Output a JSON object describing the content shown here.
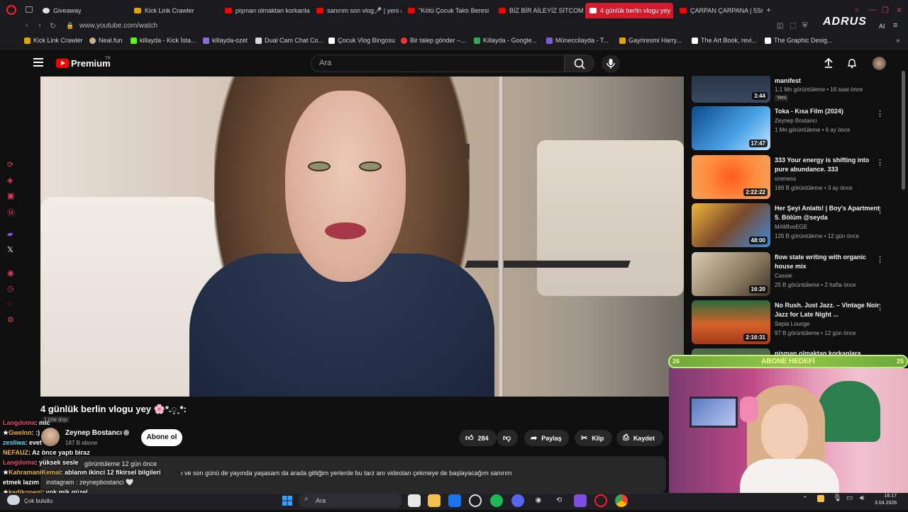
{
  "browser": {
    "tabs": [
      {
        "label": "Giveaway",
        "active": false
      },
      {
        "label": "Kick Link Crawler",
        "active": false
      },
      {
        "label": "pişman olmaktan korkanla",
        "active": false
      },
      {
        "label": "sanırım son vlog🎤 | yeni a",
        "active": false
      },
      {
        "label": "\"Kötü Çocuk Taktı Beresi",
        "active": false
      },
      {
        "label": "BİZ BİR AİLEYİZ SİTCOM",
        "active": false
      },
      {
        "label": "4 günlük berlin vlogu yey",
        "active": true
      },
      {
        "label": "ÇARPAN ÇARPANA | 5Sn",
        "active": false
      }
    ],
    "url": "www.youtube.com/watch",
    "overlay_brand": "ADRUS",
    "ai_label": "AI",
    "bookmarks": [
      "Kick Link Crawler",
      "Neal.fun",
      "killayda - Kick İsta...",
      "killayda-ozet",
      "Dual Cam Chat Co...",
      "Çocuk Vlog Bingosu",
      "Bir talep gönder –...",
      "Killayda - Google...",
      "Müneccilayda - T...",
      "Gayriresmi Harry...",
      "The Art Book, revi...",
      "The Graphic Desig..."
    ]
  },
  "youtube": {
    "brand": "Premium",
    "region": "TR",
    "search_placeholder": "Ara",
    "video": {
      "title": "4 günlük berlin vlogu yey 🌸*.◌̥˳*:",
      "visibility": "Liste dışı",
      "channel": "Zeynep Bostancı",
      "subscribers": "187 B abone",
      "subscribe_label": "Abone ol",
      "likes": "284",
      "share_label": "Paylaş",
      "clip_label": "Klip",
      "save_label": "Kaydet",
      "views_time": "görüntüleme  12 gün önce",
      "description": "ı ve son günü de yayında yaşasam da arada gittiğim yerlerde bu tarz anı videoları çekmeye de başlayacağım sanırım",
      "instagram": "instagram : zeynepbostanci 🤍"
    },
    "recommendations": [
      {
        "title": "manifest",
        "channel": "",
        "meta": "1,1 Mn görüntüleme • 16 saat önce",
        "badge": "Yeni",
        "duration": "3:44"
      },
      {
        "title": "Toka - Kısa Film (2024)",
        "channel": "Zeynep Bostancı",
        "meta": "1 Mn görüntüleme • 6 ay önce",
        "duration": "17:47"
      },
      {
        "title": "333 Your energy is shifting into pure abundance. 333",
        "channel": "oneness",
        "meta": "169 B görüntüleme • 3 ay önce",
        "duration": "2:22:22"
      },
      {
        "title": "Her Şeyi Anlattı! | Boy's Apartment 5. Bölüm @seyda",
        "channel": "MAMİveEGE",
        "meta": "126 B görüntüleme • 12 gün önce",
        "duration": "48:00"
      },
      {
        "title": "flow state writing with organic house mix",
        "channel": "Cassie",
        "meta": "25 B görüntüleme • 2 hafta önce",
        "duration": "16:20"
      },
      {
        "title": "No Rush. Just Jazz. – Vintage Noir Jazz for Late Night ...",
        "channel": "Sepia Lounge",
        "meta": "97 B görüntüleme • 12 gün önce",
        "duration": "2:16:31"
      },
      {
        "title": "pişman olmaktan korkanlara",
        "channel": "",
        "meta": "",
        "duration": ""
      }
    ]
  },
  "chat": [
    {
      "user": "Langdoma",
      "msg": "mic",
      "color": "u2"
    },
    {
      "user": "Gwelnn",
      "msg": ":)",
      "color": "u"
    },
    {
      "user": "zesliwa",
      "msg": "evet",
      "color": "u3"
    },
    {
      "user": "NEFAUZ",
      "msg": "Az önce yaptı biraz",
      "color": "u"
    },
    {
      "user": "Langdoma",
      "msg": "yüksek sesle",
      "color": "u2"
    },
    {
      "user": "KahramaniKemal",
      "msg": "ablanın ikinci 12 fikirsel bilgileri",
      "color": "u"
    },
    {
      "user": "",
      "msg": "etmek lazım",
      "color": ""
    },
    {
      "user": "kedikopegi",
      "msg": "yok mik güzel",
      "color": "u"
    }
  ],
  "stream_overlay": {
    "goal_label": "ABONE HEDEFİ",
    "goal_current": "26",
    "goal_target": "25"
  },
  "taskbar": {
    "weather": "Çok bulutlu",
    "search": "Ara",
    "time": "16:17",
    "date": "3.04.2026"
  }
}
